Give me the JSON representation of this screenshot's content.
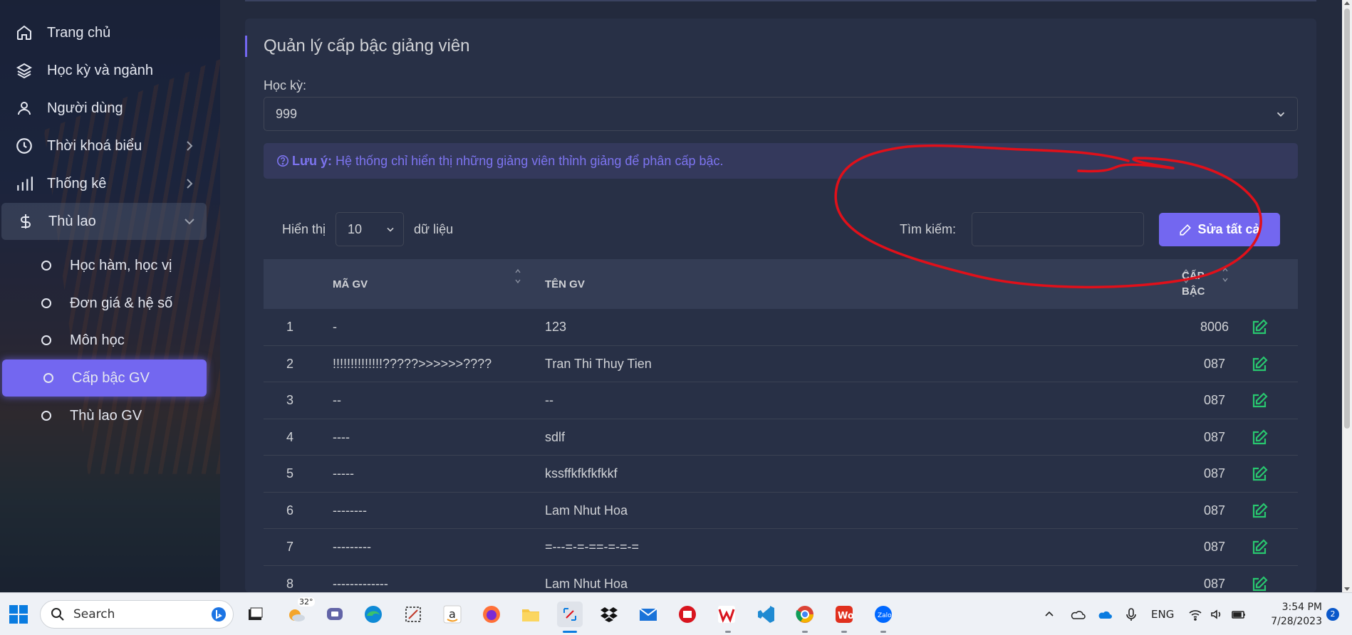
{
  "sidebar": {
    "items": [
      {
        "label": "Trang chủ",
        "icon": "home-icon"
      },
      {
        "label": "Học kỳ và ngành",
        "icon": "layers-icon"
      },
      {
        "label": "Người dùng",
        "icon": "user-icon"
      },
      {
        "label": "Thời khoá biểu",
        "icon": "clock-icon"
      },
      {
        "label": "Thống kê",
        "icon": "bar-chart-icon"
      },
      {
        "label": "Thù lao",
        "icon": "dollar-icon"
      }
    ],
    "subitems": [
      {
        "label": "Học hàm, học vị"
      },
      {
        "label": "Đơn giá & hệ số"
      },
      {
        "label": "Môn học"
      },
      {
        "label": "Cấp bậc GV"
      },
      {
        "label": "Thù lao GV"
      }
    ]
  },
  "page": {
    "title": "Quản lý cấp bậc giảng viên",
    "semester_label": "Học kỳ:",
    "semester_value": "999",
    "alert_strong": "Lưu ý:",
    "alert_text": " Hệ thống chỉ hiển thị những giảng viên thỉnh giảng để phân cấp bậc.",
    "show_label": "Hiển thị",
    "per_page": "10",
    "records_label": "dữ liệu",
    "search_label": "Tìm kiếm:",
    "search_value": "",
    "edit_all_label": "Sửa tất cả"
  },
  "table": {
    "columns": [
      "MÃ GV",
      "TÊN GV",
      "CẤP",
      "BẬC"
    ],
    "rows": [
      {
        "no": "1",
        "code": "-",
        "name": "123",
        "level": "8006"
      },
      {
        "no": "2",
        "code": "!!!!!!!!!!!!!!?????>>>>>>????",
        "name": "Tran Thi Thuy Tien",
        "level": "087"
      },
      {
        "no": "3",
        "code": "--",
        "name": "--",
        "level": "087"
      },
      {
        "no": "4",
        "code": "----",
        "name": "sdlf",
        "level": "087"
      },
      {
        "no": "5",
        "code": "-----",
        "name": "kssffkfkfkfkkf",
        "level": "087"
      },
      {
        "no": "6",
        "code": "--------",
        "name": "Lam Nhut Hoa",
        "level": "087"
      },
      {
        "no": "7",
        "code": "---------",
        "name": "=---=-=-==-=-=-=",
        "level": "087"
      },
      {
        "no": "8",
        "code": "-------------",
        "name": "Lam Nhut Hoa",
        "level": "087"
      }
    ]
  },
  "taskbar": {
    "search_placeholder": "Search",
    "weather": "32°",
    "language": "ENG",
    "time": "3:54 PM",
    "date": "7/28/2023",
    "notifications": "2"
  },
  "colors": {
    "accent": "#7367f0",
    "card": "#283046",
    "background": "#232a3d",
    "edit_icon": "#28c76f",
    "annotation": "#e0101a"
  }
}
